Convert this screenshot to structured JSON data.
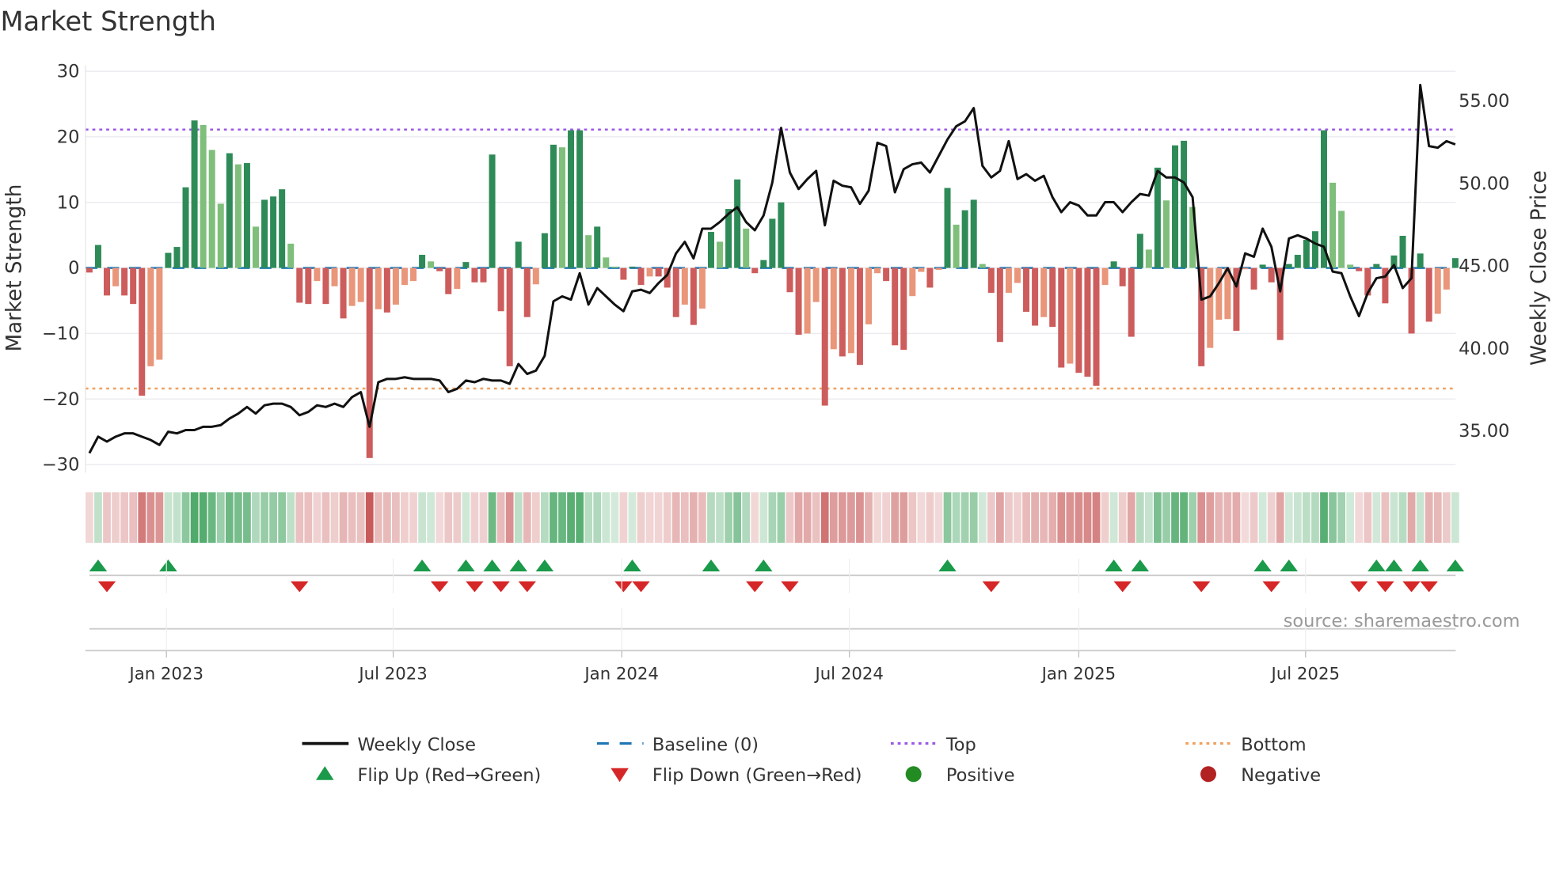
{
  "chart_data": {
    "type": "bar",
    "title": "Market Strength",
    "ylabel": "Market Strength",
    "y2label": "Weekly Close Price",
    "ylim": [
      -31,
      31
    ],
    "y2lim": [
      32.5,
      57
    ],
    "yticks": [
      "30",
      "20",
      "10",
      "0",
      "−10",
      "−20",
      "−30"
    ],
    "ytick_values": [
      30,
      20,
      10,
      0,
      -10,
      -20,
      -30
    ],
    "y2ticks": [
      "55.00",
      "50.00",
      "45.00",
      "40.00",
      "35.00"
    ],
    "y2tick_values": [
      55,
      50,
      45,
      40,
      35
    ],
    "xticks": [
      {
        "label": "Jan 2023",
        "week": 8.8
      },
      {
        "label": "Jul 2023",
        "week": 34.7
      },
      {
        "label": "Jan 2024",
        "week": 60.8
      },
      {
        "label": "Jul 2024",
        "week": 86.8
      },
      {
        "label": "Jan 2025",
        "week": 113
      },
      {
        "label": "Jul 2025",
        "week": 138.9
      }
    ],
    "top_level": 21.1,
    "bottom_level": -18.4,
    "strength": [
      -0.7,
      3.5,
      -4.2,
      -2.8,
      -4.2,
      -5.5,
      -19.5,
      -15,
      -14,
      2.3,
      3.2,
      12.3,
      22.5,
      21.8,
      18,
      9.8,
      17.5,
      15.8,
      16,
      6.3,
      10.4,
      10.9,
      12,
      3.7,
      -5.3,
      -5.5,
      -2,
      -5.5,
      -2.8,
      -7.7,
      -5.8,
      -5.2,
      -29,
      -6.3,
      -6.8,
      -5.6,
      -2.6,
      -2,
      2,
      1,
      -0.5,
      -4,
      -3.2,
      0.9,
      -2.2,
      -2.2,
      17.3,
      -6.6,
      -15,
      4,
      -7.5,
      -2.5,
      5.3,
      18.8,
      18.4,
      21,
      21,
      5,
      6.3,
      1.6,
      0.2,
      -1.8,
      0.2,
      -2.6,
      -1.3,
      -1.3,
      -3,
      -7.5,
      -5.6,
      -8.7,
      -6.2,
      5.5,
      4,
      9,
      13.5,
      6,
      -0.8,
      1.2,
      7.5,
      10,
      -3.7,
      -10.2,
      -10,
      -5.2,
      -21,
      -12.4,
      -13.5,
      -13,
      -14.8,
      -8.6,
      -0.8,
      -2,
      -11.8,
      -12.5,
      -4.3,
      -0.6,
      -3,
      -0.3,
      12.2,
      6.6,
      8.8,
      10.4,
      0.6,
      -3.8,
      -11.3,
      -3.8,
      -2.3,
      -6.7,
      -8.8,
      -7.5,
      -9,
      -15.2,
      -14.6,
      -16,
      -16.6,
      -18,
      -2.6,
      1,
      -2.8,
      -10.5,
      5.2,
      2.8,
      15.3,
      10.3,
      18.7,
      19.4,
      9.3,
      -15,
      -12.2,
      -7.9,
      -7.8,
      -9.6,
      -0.2,
      -3.3,
      0.5,
      -2.2,
      -11,
      0.6,
      2,
      4.3,
      5.6,
      21,
      13,
      8.7,
      0.5,
      -0.5,
      -4.2,
      0.6,
      -5.4,
      1.9,
      4.9,
      -10,
      2.2,
      -8.2,
      -7,
      -3.3,
      1.5
    ],
    "weekly_close": [
      33.6,
      34.6,
      34.3,
      34.6,
      34.8,
      34.8,
      34.6,
      34.4,
      34.1,
      34.9,
      34.8,
      35.0,
      35.0,
      35.2,
      35.2,
      35.3,
      35.7,
      36.0,
      36.4,
      36.0,
      36.5,
      36.6,
      36.6,
      36.4,
      35.9,
      36.1,
      36.5,
      36.4,
      36.6,
      36.4,
      37.0,
      37.3,
      35.2,
      37.9,
      38.1,
      38.1,
      38.2,
      38.1,
      38.1,
      38.1,
      38.0,
      37.3,
      37.5,
      38.0,
      37.9,
      38.1,
      38.0,
      38.0,
      37.8,
      39.0,
      38.4,
      38.6,
      39.5,
      42.8,
      43.1,
      42.9,
      44.5,
      42.6,
      43.6,
      43.1,
      42.6,
      42.2,
      43.4,
      43.5,
      43.3,
      43.9,
      44.4,
      45.7,
      46.4,
      45.4,
      47.2,
      47.2,
      47.6,
      48.1,
      48.5,
      47.6,
      47.1,
      48.0,
      50.0,
      53.3,
      50.6,
      49.6,
      50.2,
      50.7,
      47.4,
      50.1,
      49.8,
      49.7,
      48.7,
      49.5,
      52.4,
      52.2,
      49.4,
      50.8,
      51.1,
      51.2,
      50.6,
      51.6,
      52.6,
      53.4,
      53.7,
      54.5,
      51.0,
      50.3,
      50.7,
      52.5,
      50.2,
      50.5,
      50.1,
      50.4,
      49.1,
      48.2,
      48.8,
      48.6,
      48.0,
      48.0,
      48.8,
      48.8,
      48.2,
      48.8,
      49.3,
      49.2,
      50.7,
      50.3,
      50.3,
      50.0,
      49.1,
      42.9,
      43.1,
      43.9,
      44.8,
      43.7,
      45.7,
      45.5,
      47.2,
      46.1,
      43.4,
      46.6,
      46.8,
      46.6,
      46.3,
      46.1,
      44.6,
      44.5,
      43.1,
      41.9,
      43.3,
      44.2,
      44.3,
      45.0,
      43.6,
      44.2,
      55.9,
      52.2,
      52.1,
      52.5,
      52.3
    ],
    "legend_position": "bottom",
    "legend": [
      {
        "label": "Weekly Close",
        "symbol": "line",
        "color": "#111111"
      },
      {
        "label": "Baseline (0)",
        "symbol": "dash",
        "color": "#1f77b4"
      },
      {
        "label": "Top",
        "symbol": "dot",
        "color": "#9b59e6"
      },
      {
        "label": "Bottom",
        "symbol": "dot",
        "color": "#f0a060"
      },
      {
        "label": "Flip Up (Red→Green)",
        "symbol": "triangle-up",
        "color": "#1a9a4a"
      },
      {
        "label": "Flip Down (Green→Red)",
        "symbol": "triangle-down",
        "color": "#d62728"
      },
      {
        "label": "Positive",
        "symbol": "circle",
        "color": "#228b22"
      },
      {
        "label": "Negative",
        "symbol": "circle",
        "color": "#b22222"
      }
    ],
    "source": "source: sharemaestro.com"
  },
  "colors": {
    "pos_strong": "#2e8b57",
    "pos_weak": "#7fbf7b",
    "neg_strong": "#cd5c5c",
    "neg_weak": "#e9967a",
    "top": "#9b59e6",
    "bottom": "#f0a060",
    "baseline": "#1f77b4",
    "flip_up": "#1a9a4a",
    "flip_down": "#d62728",
    "grid": "#ececf0"
  }
}
